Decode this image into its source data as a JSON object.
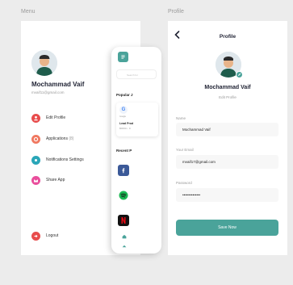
{
  "frames": {
    "menu_label": "Menu",
    "profile_label": "Profile"
  },
  "menu": {
    "user_name": "Mochammad Vaif",
    "user_email": "mvaif11@gmail.com",
    "items": [
      {
        "label": "Edit Profile",
        "icon": "user-icon",
        "color": "#e84c4c"
      },
      {
        "label": "Applications",
        "count": "(8)",
        "icon": "document-icon",
        "color": "#f07860"
      },
      {
        "label": "Notifications Settings",
        "icon": "bell-icon",
        "color": "#2aa6b8"
      },
      {
        "label": "Share App",
        "icon": "share-icon",
        "color": "#e94e9c"
      }
    ],
    "logout": {
      "label": "Logout",
      "icon": "logout-icon",
      "color": "#e84c4c"
    }
  },
  "peek": {
    "search_placeholder": "Search for",
    "popular_heading": "Popular J",
    "job_company_line": "Google",
    "job_title": "Lead Prod",
    "job_salary": "$6000/m · D",
    "recent_heading": "Recent P",
    "apps": [
      {
        "name": "facebook",
        "color": "#3b5998",
        "glyph": "f"
      },
      {
        "name": "spotify",
        "color": "#ffffff",
        "glyph": "≋"
      },
      {
        "name": "netflix",
        "color": "#111111",
        "glyph": "N"
      }
    ]
  },
  "profile": {
    "title": "Profile",
    "user_name": "Mochammad Vaif",
    "edit_label": "Edit Profile",
    "name_label": "Name",
    "name_value": "Mochammad Vaif",
    "email_label": "Your Email",
    "email_value": "mvaif17@gmail.com",
    "password_label": "Password",
    "password_value": "••••••••••••••",
    "save_label": "Save Now"
  },
  "colors": {
    "accent": "#4aa39a",
    "background": "#ececec"
  }
}
